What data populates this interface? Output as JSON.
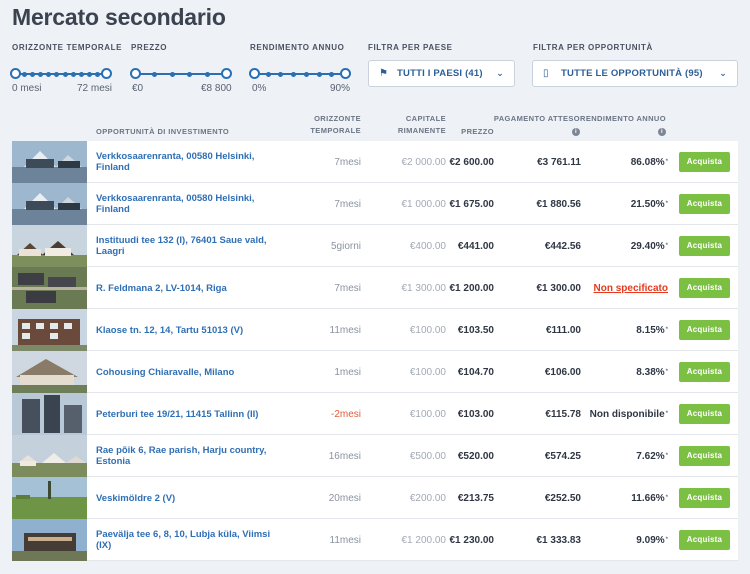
{
  "page": {
    "title": "Mercato secondario"
  },
  "filters": {
    "term": {
      "label": "ORIZZONTE TEMPORALE",
      "min": "0 mesi",
      "max": "72 mesi",
      "fill": 1.0
    },
    "price": {
      "label": "PREZZO",
      "min": "€0",
      "max": "€8 800",
      "fill": 1.0
    },
    "yield": {
      "label": "RENDIMENTO ANNUO",
      "min": "0%",
      "max": "90%",
      "fill": 1.0
    },
    "country": {
      "label": "FILTRA PER PAESE",
      "value": "TUTTI I PAESI (41)",
      "icon": "flag-icon"
    },
    "opportunity": {
      "label": "FILTRA PER OPPORTUNITÀ",
      "value": "TUTTE LE OPPORTUNITÀ (95)",
      "icon": "document-icon"
    }
  },
  "table": {
    "headers": {
      "opportunity": "OPPORTUNITÀ DI INVESTIMENTO",
      "term_line1": "ORIZZONTE",
      "term_line2": "TEMPORALE",
      "capital_line1": "CAPITALE",
      "capital_line2": "RIMANENTE",
      "price": "PREZZO",
      "payment": "PAGAMENTO ATTESO",
      "yield": "RENDIMENTO ANNUO",
      "info_glyph": "i"
    },
    "buy_label": "Acquista",
    "rows": [
      {
        "name": "Verkkosaarenranta, 00580 Helsinki, Finland",
        "term": "7mesi",
        "capital": "€2 000.00",
        "price": "€2 600.00",
        "payment": "€3 761.11",
        "yield": "86.08%",
        "mark": "*",
        "thumb": "waterfront"
      },
      {
        "name": "Verkkosaarenranta, 00580 Helsinki, Finland",
        "term": "7mesi",
        "capital": "€1 000.00",
        "price": "€1 675.00",
        "payment": "€1 880.56",
        "yield": "21.50%",
        "mark": "*",
        "thumb": "waterfront"
      },
      {
        "name": "Instituudi tee 132 (I), 76401 Saue vald, Laagri",
        "term": "5giorni",
        "capital": "€400.00",
        "price": "€441.00",
        "payment": "€442.56",
        "yield": "29.40%",
        "mark": "*",
        "thumb": "houses"
      },
      {
        "name": "R. Feldmana 2, LV-1014, Riga",
        "term": "7mesi",
        "capital": "€1 300.00",
        "price": "€1 200.00",
        "payment": "€1 300.00",
        "yield": "Non specificato",
        "mark": "",
        "thumb": "aerial"
      },
      {
        "name": "Klaose tn. 12, 14, Tartu 51013 (V)",
        "term": "11mesi",
        "capital": "€100.00",
        "price": "€103.50",
        "payment": "€111.00",
        "yield": "8.15%",
        "mark": "*",
        "thumb": "apartments"
      },
      {
        "name": "Cohousing Chiaravalle, Milano",
        "term": "1mesi",
        "capital": "€100.00",
        "price": "€104.70",
        "payment": "€106.00",
        "yield": "8.38%",
        "mark": "*",
        "thumb": "villa"
      },
      {
        "name": "Peterburi tee 19/21, 11415 Tallinn (II)",
        "term": "-2mesi",
        "capital": "€100.00",
        "price": "€103.00",
        "payment": "€115.78",
        "yield": "Non disponibile",
        "mark": "*",
        "thumb": "tower"
      },
      {
        "name": "Rae põik 6, Rae parish, Harju country, Estonia",
        "term": "16mesi",
        "capital": "€500.00",
        "price": "€520.00",
        "payment": "€574.25",
        "yield": "7.62%",
        "mark": "*",
        "thumb": "suburb"
      },
      {
        "name": "Veskimöldre 2 (V)",
        "term": "20mesi",
        "capital": "€200.00",
        "price": "€213.75",
        "payment": "€252.50",
        "yield": "11.66%",
        "mark": "*",
        "thumb": "field"
      },
      {
        "name": "Paevälja tee 6, 8, 10, Lubja küla, Viimsi (IX)",
        "term": "11mesi",
        "capital": "€1 200.00",
        "price": "€1 230.00",
        "payment": "€1 333.83",
        "yield": "9.09%",
        "mark": "*",
        "thumb": "modern"
      }
    ]
  },
  "colors": {
    "accent": "#2b6fb3",
    "buy": "#7cc043",
    "negative": "#e65b3a",
    "link": "#2f6fb5"
  }
}
